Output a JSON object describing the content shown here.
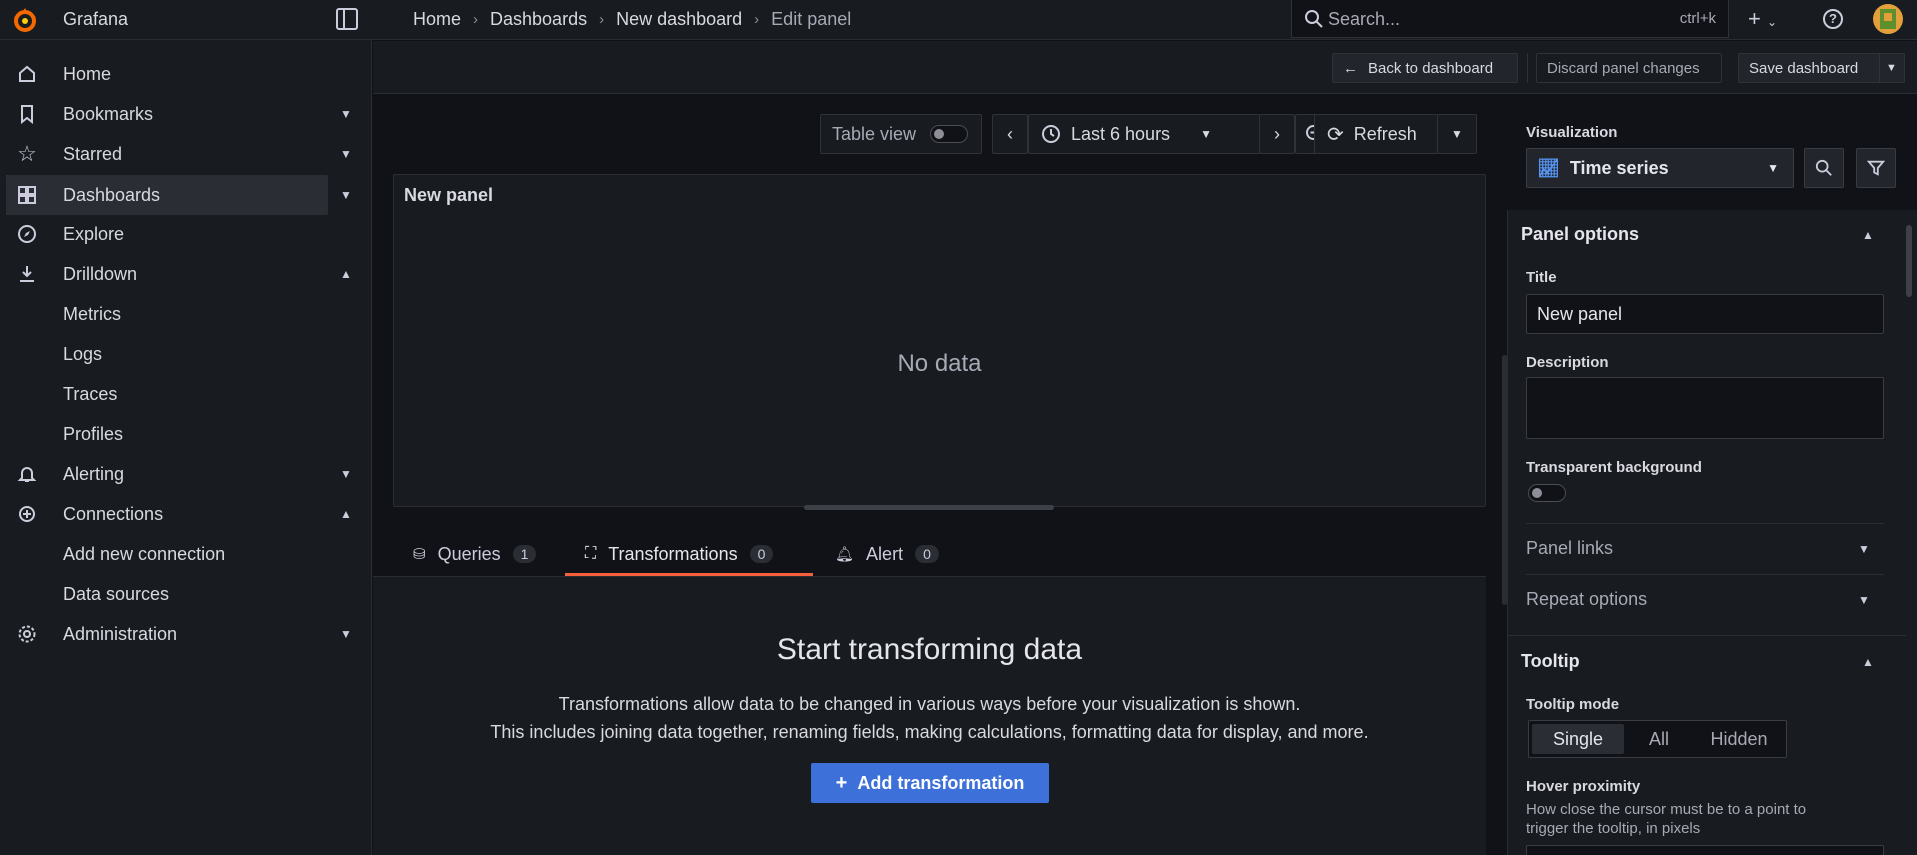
{
  "app": {
    "brand": "Grafana"
  },
  "breadcrumbs": [
    "Home",
    "Dashboards",
    "New dashboard",
    "Edit panel"
  ],
  "search": {
    "placeholder": "Search...",
    "shortcut": "ctrl+k"
  },
  "sidebar": {
    "items": [
      {
        "label": "Home",
        "icon": "home-icon"
      },
      {
        "label": "Bookmarks",
        "icon": "bookmark-icon"
      },
      {
        "label": "Starred",
        "icon": "star-icon"
      },
      {
        "label": "Dashboards",
        "icon": "apps-icon"
      },
      {
        "label": "Explore",
        "icon": "compass-icon"
      },
      {
        "label": "Drilldown",
        "icon": "drilldown-icon"
      },
      {
        "label": "Metrics"
      },
      {
        "label": "Logs"
      },
      {
        "label": "Traces"
      },
      {
        "label": "Profiles"
      },
      {
        "label": "Alerting",
        "icon": "bell-icon"
      },
      {
        "label": "Connections",
        "icon": "connections-icon"
      },
      {
        "label": "Add new connection"
      },
      {
        "label": "Data sources"
      },
      {
        "label": "Administration",
        "icon": "cog-icon"
      }
    ]
  },
  "actions": {
    "back": "Back to dashboard",
    "discard": "Discard panel changes",
    "save": "Save dashboard"
  },
  "toolbar": {
    "table_view": "Table view",
    "time_range": "Last 6 hours",
    "refresh": "Refresh"
  },
  "panel": {
    "title": "New panel",
    "empty": "No data"
  },
  "tabs": [
    {
      "label": "Queries",
      "count": "1"
    },
    {
      "label": "Transformations",
      "count": "0"
    },
    {
      "label": "Alert",
      "count": "0"
    }
  ],
  "transformations": {
    "title": "Start transforming data",
    "desc1": "Transformations allow data to be changed in various ways before your visualization is shown.",
    "desc2": "This includes joining data together, renaming fields, making calculations, formatting data for display, and more.",
    "add": "Add transformation"
  },
  "options": {
    "visualization_label": "Visualization",
    "visualization_value": "Time series",
    "panel_options": "Panel options",
    "title_label": "Title",
    "title_value": "New panel",
    "description_label": "Description",
    "transparent_label": "Transparent background",
    "panel_links": "Panel links",
    "repeat_options": "Repeat options",
    "tooltip": "Tooltip",
    "tooltip_mode_label": "Tooltip mode",
    "tooltip_modes": [
      "Single",
      "All",
      "Hidden"
    ],
    "hover_label": "Hover proximity",
    "hover_desc1": "How close the cursor must be to a point to",
    "hover_desc2": "trigger the tooltip, in pixels"
  }
}
